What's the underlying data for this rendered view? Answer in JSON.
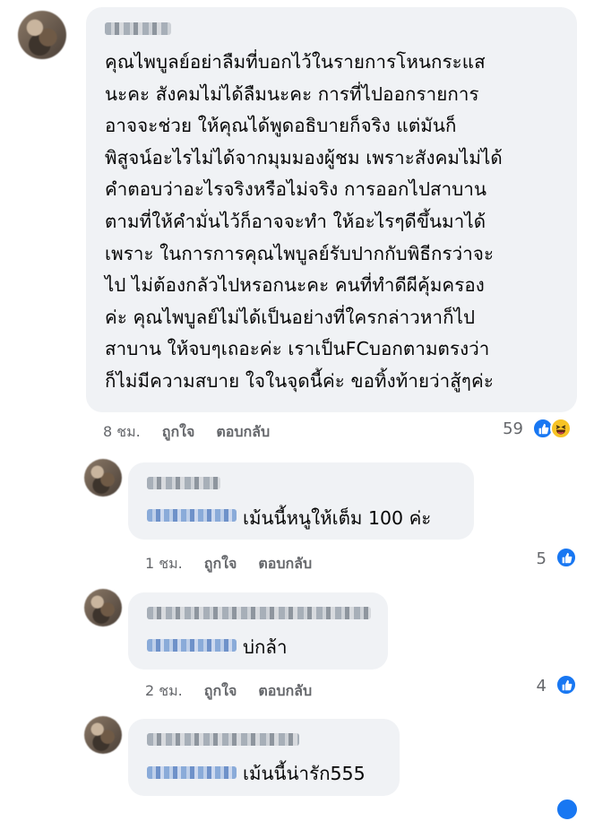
{
  "main_comment": {
    "author": "",
    "text": "คุณไพบูลย์อย่าลืมที่บอกไว้ในรายการโหนกระแส\nนะคะ สังคมไม่ได้ลืมนะคะ การที่ไปออกรายการ\nอาจจะช่วย ให้คุณได้พูดอธิบายก็จริง แต่มันก็\nพิสูจน์อะไรไม่ได้จากมุมมองผู้ชม เพราะสังคมไม่ได้\nคำตอบว่าอะไรจริงหรือไม่จริง การออกไปสาบาน\nตามที่ให้คำมั่นไว้ก็อาจจะทำ ให้อะไรๆดีขึ้นมาได้\nเพราะ ในการการคุณไพบูลย์รับปากกับพิธีกรว่าจะ\nไป ไม่ต้องกลัวไปหรอกนะคะ คนที่ทำดีผีคุ้มครอง\nค่ะ คุณไพบูลย์ไม่ได้เป็นอย่างที่ใครกล่าวหาก็ไป\nสาบาน ให้จบๆเถอะค่ะ เราเป็นFCบอกตามตรงว่า\nก็ไม่มีความสบาย ใจในจุดนี้ค่ะ ขอทิ้งท้ายว่าสู้ๆค่ะ",
    "time": "8 ชม.",
    "like_label": "ถูกใจ",
    "reply_label": "ตอบกลับ",
    "reaction_count": "59",
    "reaction_icons": [
      "like-icon",
      "haha-icon"
    ]
  },
  "replies": [
    {
      "text": "เม้นนี้หนูให้เต็ม 100 ค่ะ",
      "time": "1 ชม.",
      "like_label": "ถูกใจ",
      "reply_label": "ตอบกลับ",
      "reaction_count": "5"
    },
    {
      "text": "บ่กล้า",
      "time": "2 ชม.",
      "like_label": "ถูกใจ",
      "reply_label": "ตอบกลับ",
      "reaction_count": "4"
    },
    {
      "text": "เม้นนี้น่ารัก555",
      "time": "",
      "like_label": "",
      "reply_label": "",
      "reaction_count": ""
    }
  ],
  "colors": {
    "bubble": "#f0f2f5",
    "meta_text": "#65676b",
    "like_blue": "#1877f2",
    "haha_yellow": "#f7c325"
  }
}
